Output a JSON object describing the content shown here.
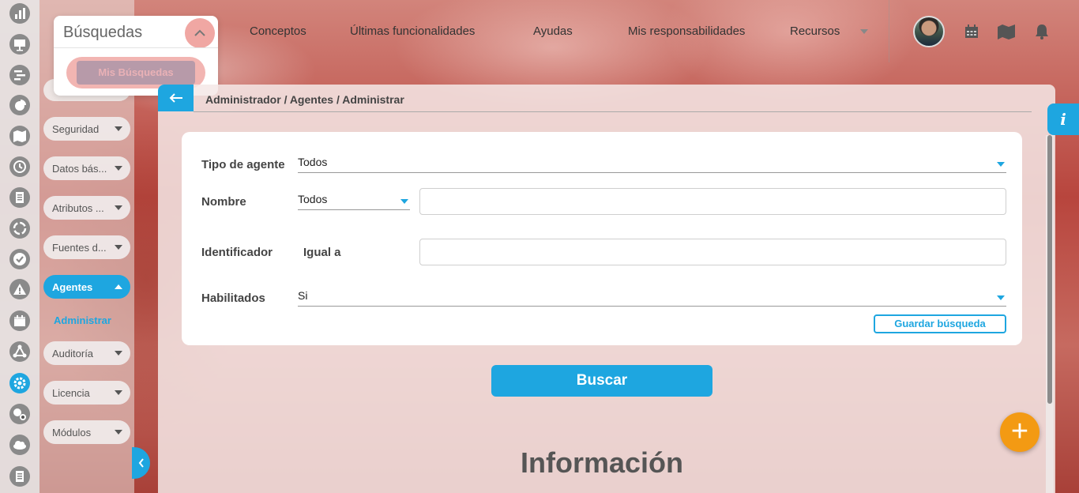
{
  "search": {
    "title": "Búsquedas",
    "my_searches_label": "Mis Búsquedas"
  },
  "topnav": {
    "items": [
      {
        "label": "Conceptos"
      },
      {
        "label": "Últimas funcionalidades"
      },
      {
        "label": "Ayudas"
      },
      {
        "label": "Mis responsabilidades"
      },
      {
        "label": "Recursos"
      }
    ]
  },
  "sidebar": {
    "items": [
      {
        "label": "Seguridad"
      },
      {
        "label": "Datos bás..."
      },
      {
        "label": "Atributos ..."
      },
      {
        "label": "Fuentes d..."
      },
      {
        "label": "Agentes"
      },
      {
        "label": "Auditoría"
      },
      {
        "label": "Licencia"
      },
      {
        "label": "Módulos"
      }
    ],
    "active_sub_item": "Administrar"
  },
  "breadcrumb": "Administrador / Agentes / Administrar",
  "form": {
    "agent_type": {
      "label": "Tipo de agente",
      "value": "Todos"
    },
    "name": {
      "label": "Nombre",
      "operator": "Todos",
      "value": ""
    },
    "identifier": {
      "label": "Identificador",
      "operator": "Igual a",
      "value": ""
    },
    "enabled": {
      "label": "Habilitados",
      "value": "Si"
    },
    "save_search_label": "Guardar búsqueda"
  },
  "search_button_label": "Buscar",
  "info_heading": "Información",
  "info_tab_label": "i",
  "fab_label": "+",
  "colors": {
    "accent": "#1ea6e0",
    "fab": "#f39a13"
  },
  "icons": {
    "rail": [
      "chart-icon",
      "presentation-icon",
      "gantt-icon",
      "pie-chart-icon",
      "map-icon",
      "clock-icon",
      "document-icon",
      "cycle-icon",
      "check-circle-icon",
      "warning-icon",
      "calendar-icon",
      "network-icon",
      "settings-icon",
      "gears-icon",
      "cloud-icon",
      "list-icon"
    ],
    "top": [
      "calendar-icon",
      "map-icon",
      "bell-icon"
    ]
  }
}
